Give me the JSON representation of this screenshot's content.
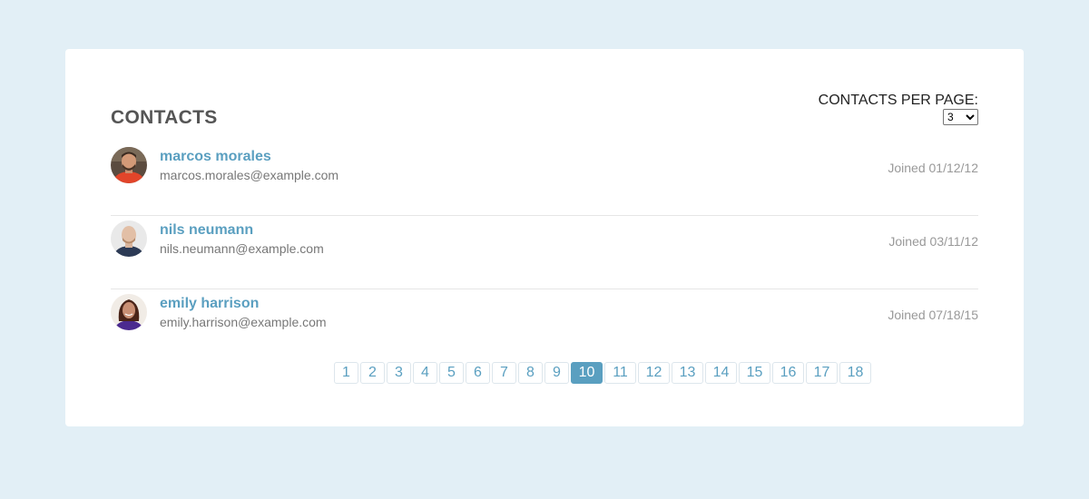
{
  "header": {
    "title": "CONTACTS",
    "per_page_label": "CONTACTS PER PAGE:",
    "per_page_value": "3"
  },
  "contacts": [
    {
      "name": "marcos morales",
      "email": "marcos.morales@example.com",
      "joined": "Joined 01/12/12"
    },
    {
      "name": "nils neumann",
      "email": "nils.neumann@example.com",
      "joined": "Joined 03/11/12"
    },
    {
      "name": "emily harrison",
      "email": "emily.harrison@example.com",
      "joined": "Joined 07/18/15"
    }
  ],
  "pagination": {
    "pages": [
      "1",
      "2",
      "3",
      "4",
      "5",
      "6",
      "7",
      "8",
      "9",
      "10",
      "11",
      "12",
      "13",
      "14",
      "15",
      "16",
      "17",
      "18"
    ],
    "current": "10"
  },
  "colors": {
    "background": "#e2eff6",
    "accent": "#5a9fc0"
  }
}
